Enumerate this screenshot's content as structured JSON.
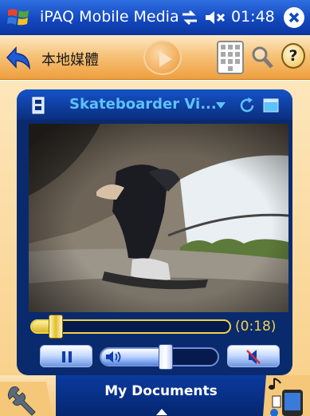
{
  "titlebar": {
    "app_title": "iPAQ Mobile Media",
    "clock": "01:48",
    "icons": [
      "windows-start-icon",
      "connectivity-icon",
      "volume-muted-icon",
      "close-icon"
    ]
  },
  "toolbar": {
    "back_icon": "back-arrow-icon",
    "label": "本地媒體",
    "play_icon": "play-icon",
    "grid_icon": "keypad-grid-icon",
    "search_icon": "search-icon",
    "help_label": "?"
  },
  "player": {
    "video_title": "Skateboarder Vi...",
    "header_icons": [
      "film-icon",
      "dropdown-icon",
      "refresh-icon",
      "window-icon"
    ],
    "seek_progress": 0.12,
    "elapsed_time": "(0:18)",
    "volume_level": 0.55,
    "controls": [
      "pause-icon",
      "speaker-icon",
      "mute-icon"
    ]
  },
  "bottom_nav": {
    "folder_label": "My Documents",
    "left_icon": "wrench-icon",
    "right_icon": "device-music-icon"
  },
  "colors": {
    "title_blue": "#1448c0",
    "toolbar_orange": "#f6c37a",
    "player_navy": "#0a2a6e",
    "title_text_cyan": "#5fc1ff",
    "seek_yellow": "#f2d24a"
  }
}
